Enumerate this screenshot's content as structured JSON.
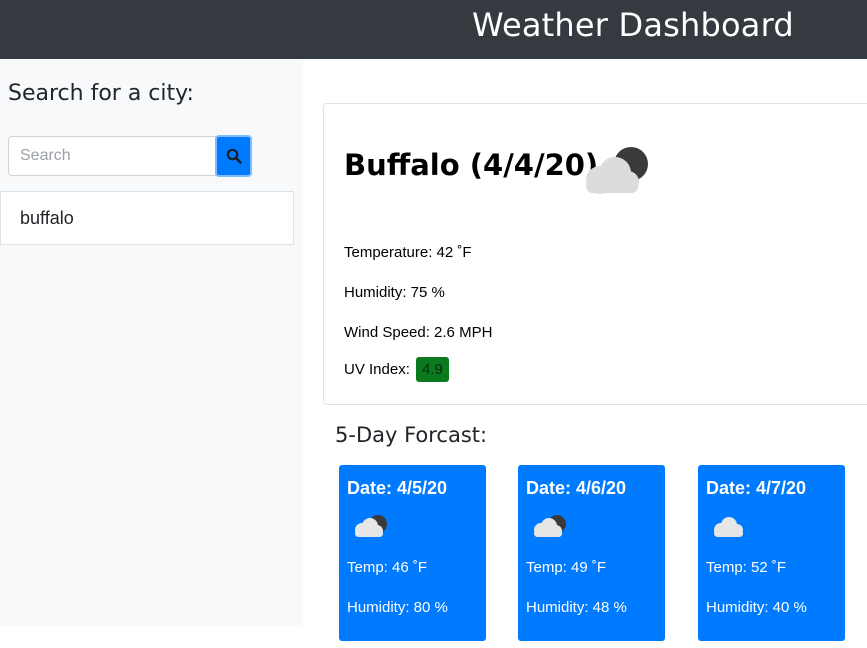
{
  "navbar": {
    "title": "Weather Dashboard"
  },
  "sidebar": {
    "heading": "Search for a city:",
    "search_placeholder": "Search",
    "search_value": "",
    "search_button_icon": "search-icon",
    "history": [
      "buffalo"
    ]
  },
  "current": {
    "title": "Buffalo (4/4/20)",
    "icon": "cloud-moon-icon",
    "temperature_label": "Temperature: 42 ˚F",
    "humidity_label": "Humidity: 75 %",
    "wind_label": "Wind Speed: 2.6 MPH",
    "uv_label": "UV Index:",
    "uv_value": "4.9",
    "uv_color": "#0b7a1e"
  },
  "forecast": {
    "heading": "5-Day Forcast:",
    "days": [
      {
        "date": "Date: 4/5/20",
        "icon": "cloud-moon-icon",
        "temp": "Temp: 46 ˚F",
        "humidity": "Humidity: 80 %"
      },
      {
        "date": "Date: 4/6/20",
        "icon": "cloud-moon-icon",
        "temp": "Temp: 49 ˚F",
        "humidity": "Humidity: 48 %"
      },
      {
        "date": "Date: 4/7/20",
        "icon": "cloud-icon",
        "temp": "Temp: 52 ˚F",
        "humidity": "Humidity: 40 %"
      }
    ]
  },
  "colors": {
    "navbar": "#343a40",
    "sidebar": "#f8f9fa",
    "primary": "#007bff",
    "uv_badge": "#0b7a1e"
  }
}
